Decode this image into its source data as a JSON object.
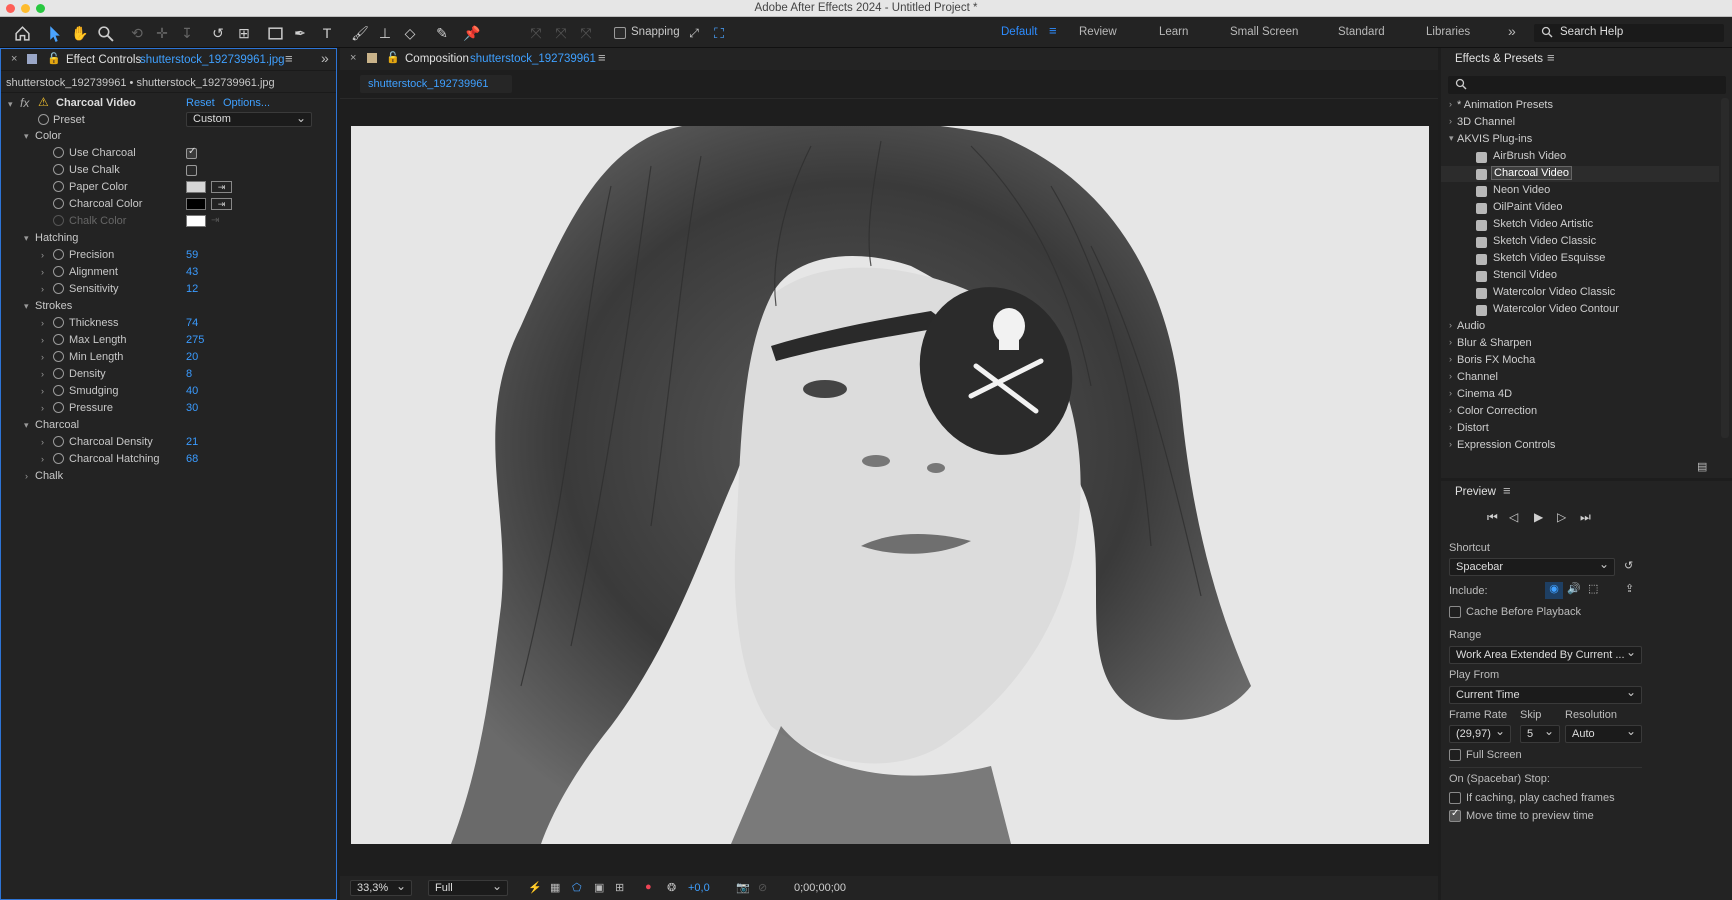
{
  "window": {
    "title": "Adobe After Effects 2024 - Untitled Project *"
  },
  "toolbar": {
    "snapping_label": "Snapping",
    "snapping_checked": false
  },
  "workspaces": {
    "items": [
      "Default",
      "Review",
      "Learn",
      "Small Screen",
      "Standard",
      "Libraries"
    ],
    "active": "Default",
    "search_placeholder": "Search Help"
  },
  "effect_controls": {
    "tab_label": "Effect Controls",
    "tab_file": "shutterstock_192739961.jpg",
    "subtitle": "shutterstock_192739961 • shutterstock_192739961.jpg",
    "effect_name": "Charcoal Video",
    "reset_label": "Reset",
    "options_label": "Options...",
    "preset_label": "Preset",
    "preset_value": "Custom",
    "groups": {
      "color": "Color",
      "hatching": "Hatching",
      "strokes": "Strokes",
      "charcoal": "Charcoal",
      "chalk": "Chalk"
    },
    "color": {
      "use_charcoal": "Use Charcoal",
      "use_charcoal_checked": true,
      "use_chalk": "Use Chalk",
      "use_chalk_checked": false,
      "paper_color": "Paper Color",
      "paper_color_hex": "#d6d6d6",
      "charcoal_color": "Charcoal Color",
      "charcoal_color_hex": "#000000",
      "chalk_color": "Chalk Color",
      "chalk_color_hex": "#ffffff"
    },
    "hatching": [
      {
        "label": "Precision",
        "value": "59"
      },
      {
        "label": "Alignment",
        "value": "43"
      },
      {
        "label": "Sensitivity",
        "value": "12"
      }
    ],
    "strokes": [
      {
        "label": "Thickness",
        "value": "74"
      },
      {
        "label": "Max Length",
        "value": "275"
      },
      {
        "label": "Min Length",
        "value": "20"
      },
      {
        "label": "Density",
        "value": "8"
      },
      {
        "label": "Smudging",
        "value": "40"
      },
      {
        "label": "Pressure",
        "value": "30"
      }
    ],
    "charcoal": [
      {
        "label": "Charcoal Density",
        "value": "21"
      },
      {
        "label": "Charcoal Hatching",
        "value": "68"
      }
    ]
  },
  "composition": {
    "tab_label": "Composition",
    "tab_name": "shutterstock_192739961",
    "layer_tab": "shutterstock_192739961",
    "zoom": "33,3%",
    "resolution": "Full",
    "exposure": "+0,0",
    "timecode": "0;00;00;00"
  },
  "effects_presets": {
    "title": "Effects & Presets",
    "tree": [
      {
        "label": "* Animation Presets",
        "expanded": false,
        "level": 0
      },
      {
        "label": "3D Channel",
        "expanded": false,
        "level": 0
      },
      {
        "label": "AKVIS Plug-ins",
        "expanded": true,
        "level": 0
      },
      {
        "label": "AirBrush Video",
        "level": 1
      },
      {
        "label": "Charcoal Video",
        "level": 1,
        "selected": true
      },
      {
        "label": "Neon Video",
        "level": 1
      },
      {
        "label": "OilPaint Video",
        "level": 1
      },
      {
        "label": "Sketch Video Artistic",
        "level": 1
      },
      {
        "label": "Sketch Video Classic",
        "level": 1
      },
      {
        "label": "Sketch Video Esquisse",
        "level": 1
      },
      {
        "label": "Stencil Video",
        "level": 1
      },
      {
        "label": "Watercolor Video Classic",
        "level": 1
      },
      {
        "label": "Watercolor Video Contour",
        "level": 1
      },
      {
        "label": "Audio",
        "expanded": false,
        "level": 0
      },
      {
        "label": "Blur & Sharpen",
        "expanded": false,
        "level": 0
      },
      {
        "label": "Boris FX Mocha",
        "expanded": false,
        "level": 0
      },
      {
        "label": "Channel",
        "expanded": false,
        "level": 0
      },
      {
        "label": "Cinema 4D",
        "expanded": false,
        "level": 0
      },
      {
        "label": "Color Correction",
        "expanded": false,
        "level": 0
      },
      {
        "label": "Distort",
        "expanded": false,
        "level": 0
      },
      {
        "label": "Expression Controls",
        "expanded": false,
        "level": 0
      }
    ]
  },
  "preview": {
    "title": "Preview",
    "shortcut_label": "Shortcut",
    "shortcut_value": "Spacebar",
    "include_label": "Include:",
    "cache_label": "Cache Before Playback",
    "cache_checked": false,
    "range_label": "Range",
    "range_value": "Work Area Extended By Current ...",
    "play_from_label": "Play From",
    "play_from_value": "Current Time",
    "frame_rate_label": "Frame Rate",
    "frame_rate_value": "(29,97)",
    "skip_label": "Skip",
    "skip_value": "5",
    "resolution_label": "Resolution",
    "resolution_value": "Auto",
    "full_screen_label": "Full Screen",
    "full_screen_checked": false,
    "stop_label": "On (Spacebar) Stop:",
    "if_caching_label": "If caching, play cached frames",
    "if_caching_checked": false,
    "move_time_label": "Move time to preview time",
    "move_time_checked": true
  },
  "colors": {
    "accent": "#2d8cff",
    "panel": "#232323",
    "viewer_bg": "#1e1e1e"
  }
}
